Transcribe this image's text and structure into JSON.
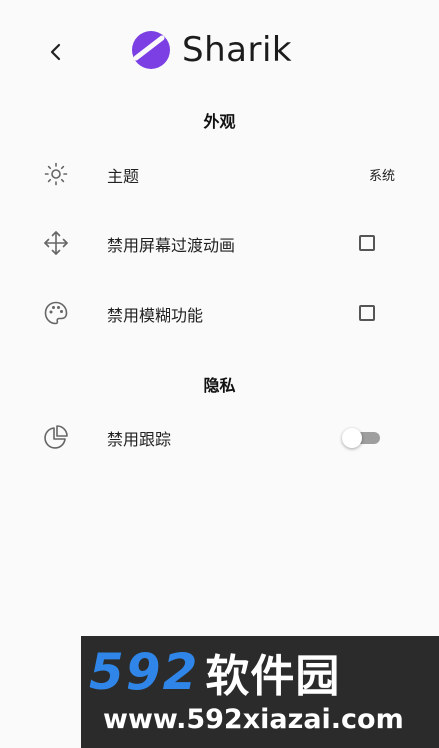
{
  "header": {
    "back_icon": "chevron-left-icon",
    "app_name": "Sharik",
    "logo_color": "#7b3fe4"
  },
  "sections": {
    "appearance": {
      "title": "外观",
      "theme": {
        "label": "主题",
        "value": "系统",
        "icon": "sun-icon"
      },
      "disable_transitions": {
        "label": "禁用屏幕过渡动画",
        "icon": "move-arrows-icon",
        "checked": false
      },
      "disable_blur": {
        "label": "禁用模糊功能",
        "icon": "palette-icon",
        "checked": false
      }
    },
    "privacy": {
      "title": "隐私",
      "disable_tracking": {
        "label": "禁用跟踪",
        "icon": "pie-chart-icon",
        "enabled": false
      }
    }
  },
  "watermark": {
    "digits": "592",
    "name": "软件园",
    "url": "www.592xiazai.com",
    "digit_color": "#2f86e8"
  }
}
